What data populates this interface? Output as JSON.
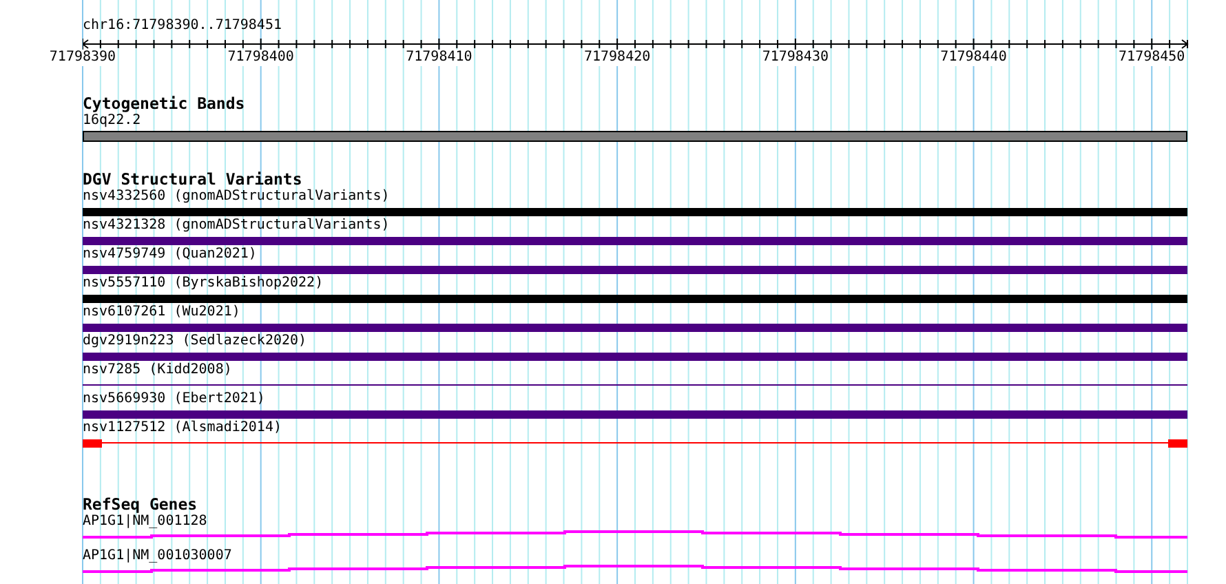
{
  "location": "chr16:71798390..71798451",
  "ruler": {
    "labels": [
      "71798390",
      "71798400",
      "71798410",
      "71798420",
      "71798430",
      "71798440",
      "71798450"
    ]
  },
  "cytogenetic_bands": {
    "title": "Cytogenetic Bands",
    "features": [
      {
        "label": "16q22.2"
      }
    ]
  },
  "structural_variants": {
    "title": "DGV Structural Variants",
    "features": [
      {
        "label": "nsv4332560 (gnomADStructuralVariants)",
        "kind": "thick",
        "color": "#000000"
      },
      {
        "label": "nsv4321328 (gnomADStructuralVariants)",
        "kind": "thick",
        "color": "#4b0082"
      },
      {
        "label": "nsv4759749 (Quan2021)",
        "kind": "thick",
        "color": "#4b0082"
      },
      {
        "label": "nsv5557110 (ByrskaBishop2022)",
        "kind": "thick",
        "color": "#000000"
      },
      {
        "label": "nsv6107261 (Wu2021)",
        "kind": "thick",
        "color": "#4b0082"
      },
      {
        "label": "dgv2919n223 (Sedlazeck2020)",
        "kind": "thick",
        "color": "#4b0082"
      },
      {
        "label": "nsv7285 (Kidd2008)",
        "kind": "thin",
        "color": "#4b0082"
      },
      {
        "label": "nsv5669930 (Ebert2021)",
        "kind": "thick",
        "color": "#4b0082"
      },
      {
        "label": "nsv1127512 (Alsmadi2014)",
        "kind": "ends",
        "color": "#ff0000"
      }
    ]
  },
  "refseq_genes": {
    "title": "RefSeq Genes",
    "features": [
      {
        "label": "AP1G1|NM_001128"
      },
      {
        "label": "AP1G1|NM_001030007"
      }
    ]
  }
}
